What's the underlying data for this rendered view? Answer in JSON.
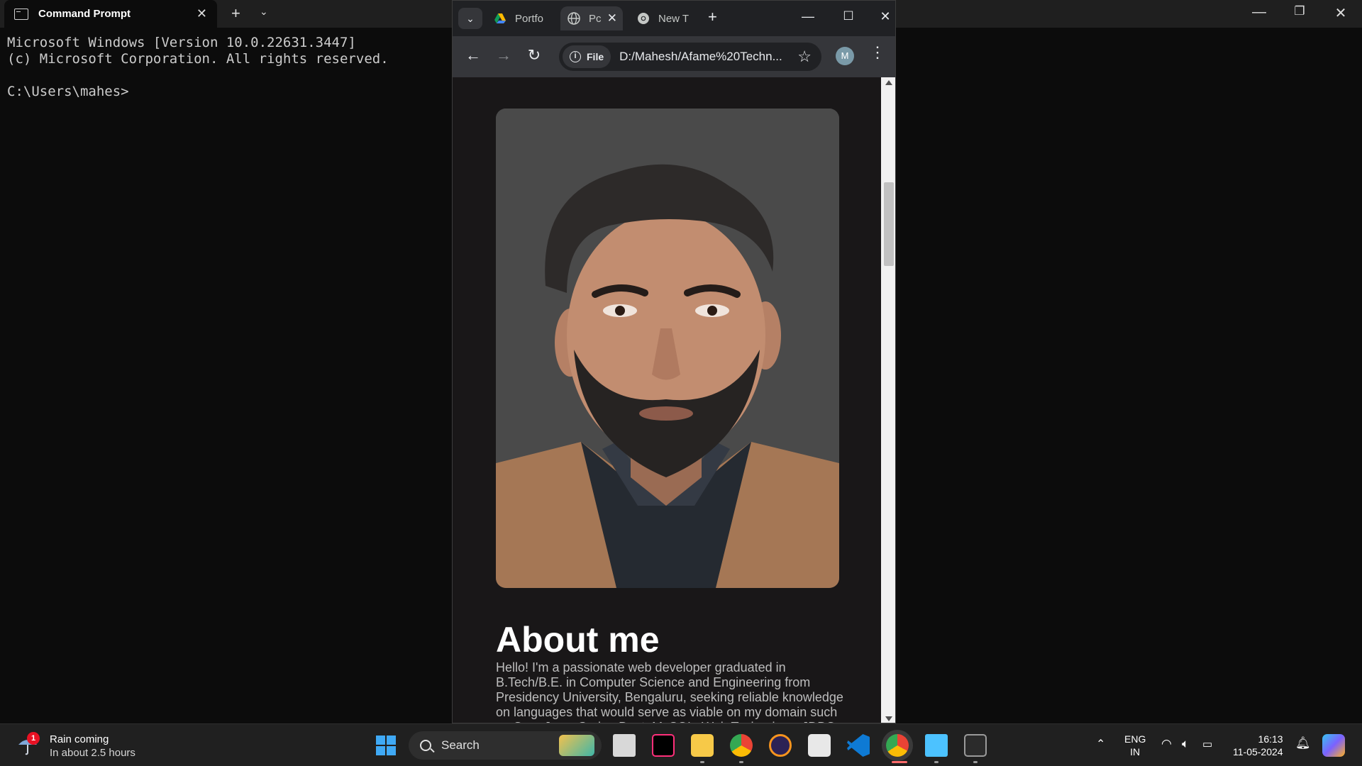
{
  "terminal": {
    "tab_title": "Command Prompt",
    "lines": [
      "Microsoft Windows [Version 10.0.22631.3447]",
      "(c) Microsoft Corporation. All rights reserved.",
      "",
      "C:\\Users\\mahes>"
    ]
  },
  "browser": {
    "tabs": [
      {
        "label": "Portfo",
        "icon": "google-drive-icon"
      },
      {
        "label": "Pc",
        "icon": "globe-icon",
        "active": true
      },
      {
        "label": "New T",
        "icon": "chrome-icon"
      }
    ],
    "address": {
      "chip_label": "File",
      "url": "D:/Mahesh/Afame%20Techn..."
    },
    "profile_initial": "M",
    "page": {
      "about_title": "About me",
      "about_text": "Hello! I'm a passionate web developer graduated in B.Tech/B.E. in Computer Science and Engineering from Presidency University, Bengaluru, seeking reliable knowledge on languages that would serve as viable on my domain such as Core Java, Spring Boot, MySQL, Web Technology, JDBC"
    }
  },
  "taskbar": {
    "weather_title": "Rain coming",
    "weather_sub": "In about 2.5 hours",
    "weather_badge": "1",
    "search_label": "Search",
    "lang_line1": "ENG",
    "lang_line2": "IN",
    "time": "16:13",
    "date": "11-05-2024"
  },
  "colors": {
    "terminal_bg": "#0c0c0c",
    "page_bg": "#191718",
    "chrome_toolbar": "#35363a",
    "taskbar_bg": "#202020"
  }
}
